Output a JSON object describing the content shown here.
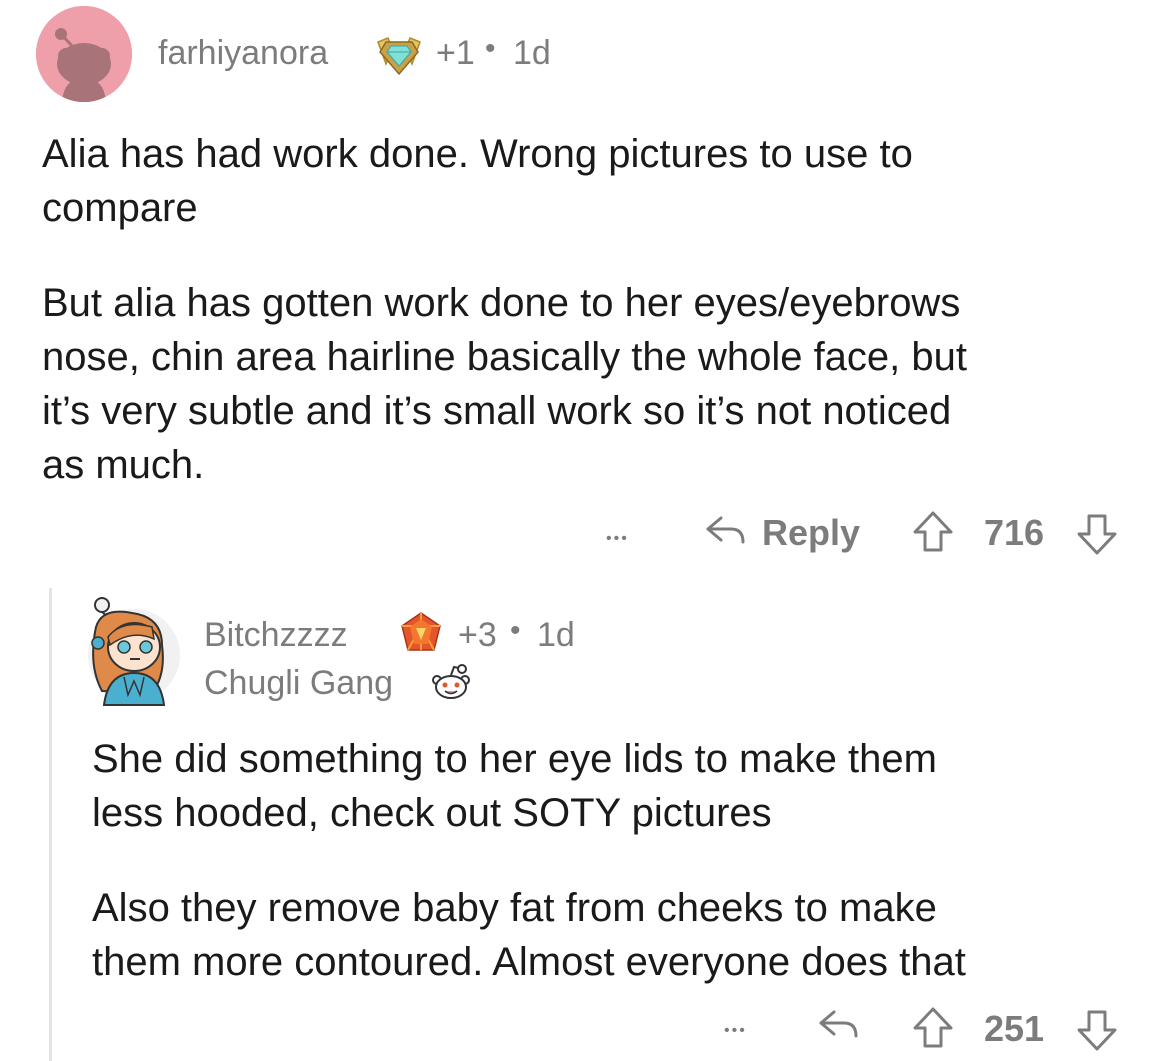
{
  "comment1": {
    "username": "farhiyanora",
    "award_count": "+1",
    "separator": "•",
    "age": "1d",
    "paragraph1_line1": "Alia has had work done. Wrong pictures to use to",
    "paragraph1_line2": "compare",
    "paragraph2_line1": "But alia has gotten work done to her eyes/eyebrows",
    "paragraph2_line2": "nose, chin area hairline basically the whole face, but",
    "paragraph2_line3": "it’s very subtle and it’s small work so it’s not noticed",
    "paragraph2_line4": "as much.",
    "more": "•••",
    "reply_label": "Reply",
    "score": "716"
  },
  "comment2": {
    "username": "Bitchzzzz",
    "award_count": "+3",
    "separator": "•",
    "age": "1d",
    "flair": "Chugli Gang",
    "paragraph1_line1": "She did something to her eye lids to make them",
    "paragraph1_line2": "less hooded, check out SOTY pictures",
    "paragraph2_line1": "Also they remove baby fat from cheeks to make",
    "paragraph2_line2": "them more contoured. Almost everyone does that",
    "more": "•••",
    "score": "251"
  },
  "colors": {
    "meta_gray": "#7c7c7c",
    "text": "#1a1a1b",
    "avatar1_bg": "#ee9fa9",
    "thread_line": "#e3e3e3"
  }
}
